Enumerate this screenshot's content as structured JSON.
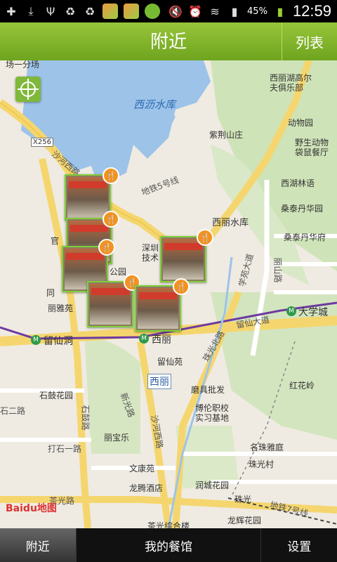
{
  "status": {
    "battery": "45%",
    "time": "12:59"
  },
  "titlebar": {
    "title": "附近",
    "list_button": "列表"
  },
  "map": {
    "labels": {
      "top_left": "场一分场",
      "reservoir": "西沥水库",
      "x256": "X256",
      "shahe_rd": "沙河西路",
      "xili_gaoerfu": "西丽湖高尔\n夫俱乐部",
      "zoo": "动物园",
      "zijingshan": "紫荆山庄",
      "wildlife": "野生动物\n袋鼠餐厅",
      "xihu_linyu": "西湖林语",
      "sangtaidanhua": "桑泰丹华园",
      "xili_reservoir_stn": "西丽水库",
      "sangtai_huayuan": "桑泰丹华府",
      "xueyuan_dadao": "学苑大道",
      "lili_rd": "丽山路",
      "shenzhen_tech": "深圳\n技术",
      "park": "公园",
      "guan": "官",
      "tong": "同",
      "liya": "丽雅苑",
      "daxuecheng": "大学城",
      "liuxiandong": "留仙洞",
      "xili_stn": "西丽",
      "liuxian_dadao": "留仙大道",
      "zhuguang_rd": "珠光北路",
      "liuxianyuan": "留仙苑",
      "xili_big": "西丽",
      "mojupifa": "磨具批发",
      "honghualing": "红花岭",
      "shigu_huayuan": "石鼓花园",
      "xinguang_rd": "新光路",
      "boluan": "博伦职校\n实习基地",
      "shier_rd": "石二路",
      "shigu_rd": "石鼓路",
      "libaole": "丽宝乐",
      "mingzhu": "名珠雅庭",
      "dashiyi_rd": "打石一路",
      "zhuguangcun": "珠光村",
      "shahe_xilu": "沙河西路",
      "wenkang": "文康苑",
      "runcheng": "润城花园",
      "longteng": "龙腾酒店",
      "chaguang_rd": "茶光路",
      "zhuguang_stn": "珠光",
      "metro7": "地铁7号线",
      "chaguang": "茶光综合楼",
      "longhui": "龙辉花园",
      "metro5": "地铁5号线"
    },
    "brand": "Baidu地图"
  },
  "tabbar": {
    "tabs": [
      {
        "label": "附近"
      },
      {
        "label": "我的餐馆"
      },
      {
        "label": "设置"
      }
    ]
  }
}
